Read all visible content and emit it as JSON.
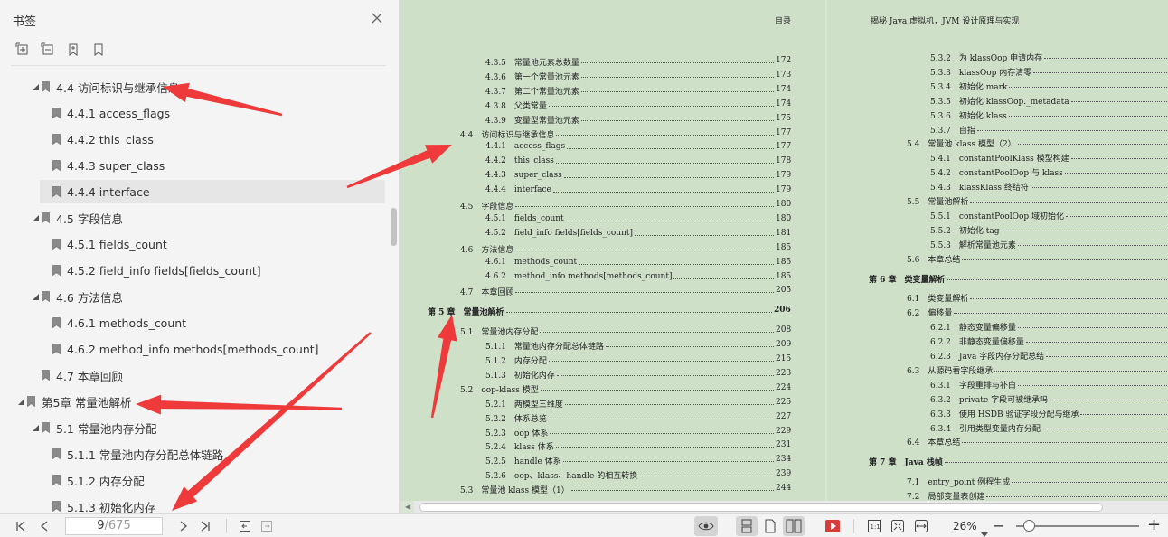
{
  "panel": {
    "title": "书签",
    "items": [
      {
        "label": "4.4 访问标识与继承信息",
        "level": 1,
        "expanded": true,
        "selected": false
      },
      {
        "label": "4.4.1 access_flags",
        "level": 2,
        "selected": false
      },
      {
        "label": "4.4.2 this_class",
        "level": 2,
        "selected": false
      },
      {
        "label": "4.4.3 super_class",
        "level": 2,
        "selected": false
      },
      {
        "label": "4.4.4 interface",
        "level": 2,
        "selected": true
      },
      {
        "label": "4.5 字段信息",
        "level": 1,
        "expanded": true,
        "selected": false
      },
      {
        "label": "4.5.1 fields_count",
        "level": 2,
        "selected": false
      },
      {
        "label": "4.5.2 field_info fields[fields_count]",
        "level": 2,
        "selected": false
      },
      {
        "label": "4.6 方法信息",
        "level": 1,
        "expanded": true,
        "selected": false
      },
      {
        "label": "4.6.1 methods_count",
        "level": 2,
        "selected": false
      },
      {
        "label": "4.6.2 method_info methods[methods_count]",
        "level": 2,
        "selected": false
      },
      {
        "label": "4.7 本章回顾",
        "level": 1,
        "expanded": false,
        "selected": false
      },
      {
        "label": "第5章 常量池解析",
        "level": 0,
        "expanded": true,
        "selected": false
      },
      {
        "label": "5.1 常量池内存分配",
        "level": 1,
        "expanded": true,
        "selected": false
      },
      {
        "label": "5.1.1 常量池内存分配总体链路",
        "level": 2,
        "selected": false
      },
      {
        "label": "5.1.2 内存分配",
        "level": 2,
        "selected": false
      },
      {
        "label": "5.1.3 初始化内存",
        "level": 2,
        "selected": false
      }
    ]
  },
  "document": {
    "left_header": "目录",
    "right_header": "揭秘 Java 虚拟机，JVM 设计原理与实现",
    "left_entries": [
      {
        "indent": 2,
        "num": "4.3.5",
        "title": "常量池元素总数量",
        "page": "172"
      },
      {
        "indent": 2,
        "num": "4.3.6",
        "title": "第一个常量池元素",
        "page": "173"
      },
      {
        "indent": 2,
        "num": "4.3.7",
        "title": "第二个常量池元素",
        "page": "174"
      },
      {
        "indent": 2,
        "num": "4.3.8",
        "title": "父类常量",
        "page": "174"
      },
      {
        "indent": 2,
        "num": "4.3.9",
        "title": "变量型常量池元素",
        "page": "175"
      },
      {
        "indent": 1,
        "num": "4.4",
        "title": "访问标识与继承信息",
        "page": "177"
      },
      {
        "indent": 2,
        "num": "4.4.1",
        "title": "access_flags",
        "page": "177"
      },
      {
        "indent": 2,
        "num": "4.4.2",
        "title": "this_class",
        "page": "178"
      },
      {
        "indent": 2,
        "num": "4.4.3",
        "title": "super_class",
        "page": "179"
      },
      {
        "indent": 2,
        "num": "4.4.4",
        "title": "interface",
        "page": "179"
      },
      {
        "indent": 1,
        "num": "4.5",
        "title": "字段信息",
        "page": "180"
      },
      {
        "indent": 2,
        "num": "4.5.1",
        "title": "fields_count",
        "page": "180"
      },
      {
        "indent": 2,
        "num": "4.5.2",
        "title": "field_info fields[fields_count]",
        "page": "181"
      },
      {
        "indent": 1,
        "num": "4.6",
        "title": "方法信息",
        "page": "185"
      },
      {
        "indent": 2,
        "num": "4.6.1",
        "title": "methods_count",
        "page": "185"
      },
      {
        "indent": 2,
        "num": "4.6.2",
        "title": "method_info methods[methods_count]",
        "page": "185"
      },
      {
        "indent": 1,
        "num": "4.7",
        "title": "本章回顾",
        "page": "205"
      },
      {
        "indent": 0,
        "num": "第 5 章",
        "title": "常量池解析",
        "page": "206"
      },
      {
        "indent": 1,
        "num": "5.1",
        "title": "常量池内存分配",
        "page": "208"
      },
      {
        "indent": 2,
        "num": "5.1.1",
        "title": "常量池内存分配总体链路",
        "page": "209"
      },
      {
        "indent": 2,
        "num": "5.1.2",
        "title": "内存分配",
        "page": "215"
      },
      {
        "indent": 2,
        "num": "5.1.3",
        "title": "初始化内存",
        "page": "223"
      },
      {
        "indent": 1,
        "num": "5.2",
        "title": "oop-klass 模型",
        "page": "224"
      },
      {
        "indent": 2,
        "num": "5.2.1",
        "title": "两模型三维度",
        "page": "225"
      },
      {
        "indent": 2,
        "num": "5.2.2",
        "title": "体系总览",
        "page": "227"
      },
      {
        "indent": 2,
        "num": "5.2.3",
        "title": "oop 体系",
        "page": "229"
      },
      {
        "indent": 2,
        "num": "5.2.4",
        "title": "klass 体系",
        "page": "231"
      },
      {
        "indent": 2,
        "num": "5.2.5",
        "title": "handle 体系",
        "page": "234"
      },
      {
        "indent": 2,
        "num": "5.2.6",
        "title": "oop、klass、handle 的相互转换",
        "page": "239"
      },
      {
        "indent": 1,
        "num": "5.3",
        "title": "常量池 klass 模型（1）",
        "page": "244"
      }
    ],
    "right_entries": [
      {
        "indent": 2,
        "num": "5.3.2",
        "title": "为 klassOop 申请内存"
      },
      {
        "indent": 2,
        "num": "5.3.3",
        "title": "klassOop 内存清零"
      },
      {
        "indent": 2,
        "num": "5.3.4",
        "title": "初始化 mark"
      },
      {
        "indent": 2,
        "num": "5.3.5",
        "title": "初始化 klassOop._metadata"
      },
      {
        "indent": 2,
        "num": "5.3.6",
        "title": "初始化 klass"
      },
      {
        "indent": 2,
        "num": "5.3.7",
        "title": "自指"
      },
      {
        "indent": 1,
        "num": "5.4",
        "title": "常量池 klass 模型（2）"
      },
      {
        "indent": 2,
        "num": "5.4.1",
        "title": "constantPoolKlass 模型构建"
      },
      {
        "indent": 2,
        "num": "5.4.2",
        "title": "constantPoolOop 与 klass"
      },
      {
        "indent": 2,
        "num": "5.4.3",
        "title": "klassKlass 终结符"
      },
      {
        "indent": 1,
        "num": "5.5",
        "title": "常量池解析"
      },
      {
        "indent": 2,
        "num": "5.5.1",
        "title": "constantPoolOop 域初始化"
      },
      {
        "indent": 2,
        "num": "5.5.2",
        "title": "初始化 tag"
      },
      {
        "indent": 2,
        "num": "5.5.3",
        "title": "解析常量池元素"
      },
      {
        "indent": 1,
        "num": "5.6",
        "title": "本章总结"
      },
      {
        "indent": 0,
        "num": "第 6 章",
        "title": "类变量解析"
      },
      {
        "indent": 1,
        "num": "6.1",
        "title": "类变量解析"
      },
      {
        "indent": 1,
        "num": "6.2",
        "title": "偏移量"
      },
      {
        "indent": 2,
        "num": "6.2.1",
        "title": "静态变量偏移量"
      },
      {
        "indent": 2,
        "num": "6.2.2",
        "title": "非静态变量偏移量"
      },
      {
        "indent": 2,
        "num": "6.2.3",
        "title": "Java 字段内存分配总结"
      },
      {
        "indent": 1,
        "num": "6.3",
        "title": "从源码看字段继承"
      },
      {
        "indent": 2,
        "num": "6.3.1",
        "title": "字段重排与补白"
      },
      {
        "indent": 2,
        "num": "6.3.2",
        "title": "private 字段可被继承吗"
      },
      {
        "indent": 2,
        "num": "6.3.3",
        "title": "使用 HSDB 验证字段分配与继承"
      },
      {
        "indent": 2,
        "num": "6.3.4",
        "title": "引用类型变量内存分配"
      },
      {
        "indent": 1,
        "num": "6.4",
        "title": "本章总结"
      },
      {
        "indent": 0,
        "num": "第 7 章",
        "title": "Java 栈帧"
      },
      {
        "indent": 1,
        "num": "7.1",
        "title": "entry_point 例程生成"
      },
      {
        "indent": 1,
        "num": "7.2",
        "title": "局部变量表创建"
      }
    ]
  },
  "statusbar": {
    "current_page": "9",
    "total_pages": "/675",
    "zoom": "26%",
    "zoom_level": 0.1
  },
  "colors": {
    "annotation_arrow": "#ee3a3a",
    "page_bg": "#cfe0c9",
    "panel_bg": "#f4f4f4"
  }
}
